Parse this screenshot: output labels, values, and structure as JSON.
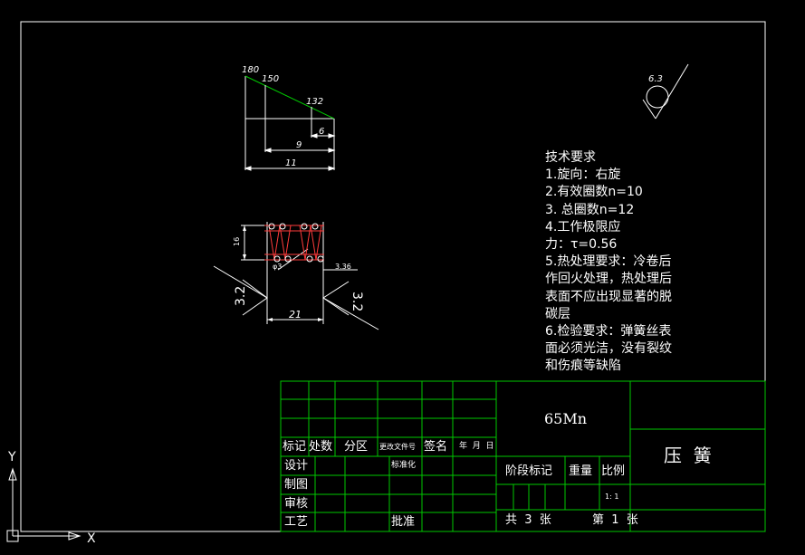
{
  "drawing": {
    "colors": {
      "background": "#000000",
      "lines": "#ffffff",
      "title_block": "#00c800",
      "spring": "#ff3b3b",
      "dims": "#00e5e5"
    },
    "chart_labels": {
      "f180": "180",
      "f150": "150",
      "f132": "132",
      "d6": "6",
      "d9": "9",
      "d11": "11",
      "roughness": "6.3"
    },
    "spring_labels": {
      "h16": "16",
      "d3": "φ3",
      "p336": "3.36",
      "w21": "21",
      "r_left": "3.2",
      "r_right": "3.2"
    },
    "requirements": [
      "技术要求",
      "1.旋向：右旋",
      "2.有效圈数n=10",
      "3.  总圈数n=12",
      "4.工作极限应",
      "力：τ=0.56",
      "5.热处理要求：冷卷后",
      "作回火处理，热处理后",
      "表面不应出现显著的脱",
      "碳层",
      "6.检验要求：弹簧丝表",
      "面必须光洁，没有裂纹",
      "和伤痕等缺陷"
    ],
    "title_block": {
      "material": "65Mn",
      "part_name": "压  簧",
      "mark": "标记",
      "count": "处数",
      "zone": "分区",
      "change_doc": "更改文件号",
      "signature": "签名",
      "date": "年  月  日",
      "design": "设计",
      "standardize": "标准化",
      "drawing": "制图",
      "check": "审核",
      "process": "工艺",
      "approve": "批准",
      "stage_mark": "阶段标记",
      "weight": "重量",
      "ratio": "比例",
      "ratio_value": "1: 1",
      "total_sheets": "共  3  张",
      "sheet_no": "第  1  张"
    },
    "axes": {
      "y": "Y",
      "x": "X"
    }
  }
}
